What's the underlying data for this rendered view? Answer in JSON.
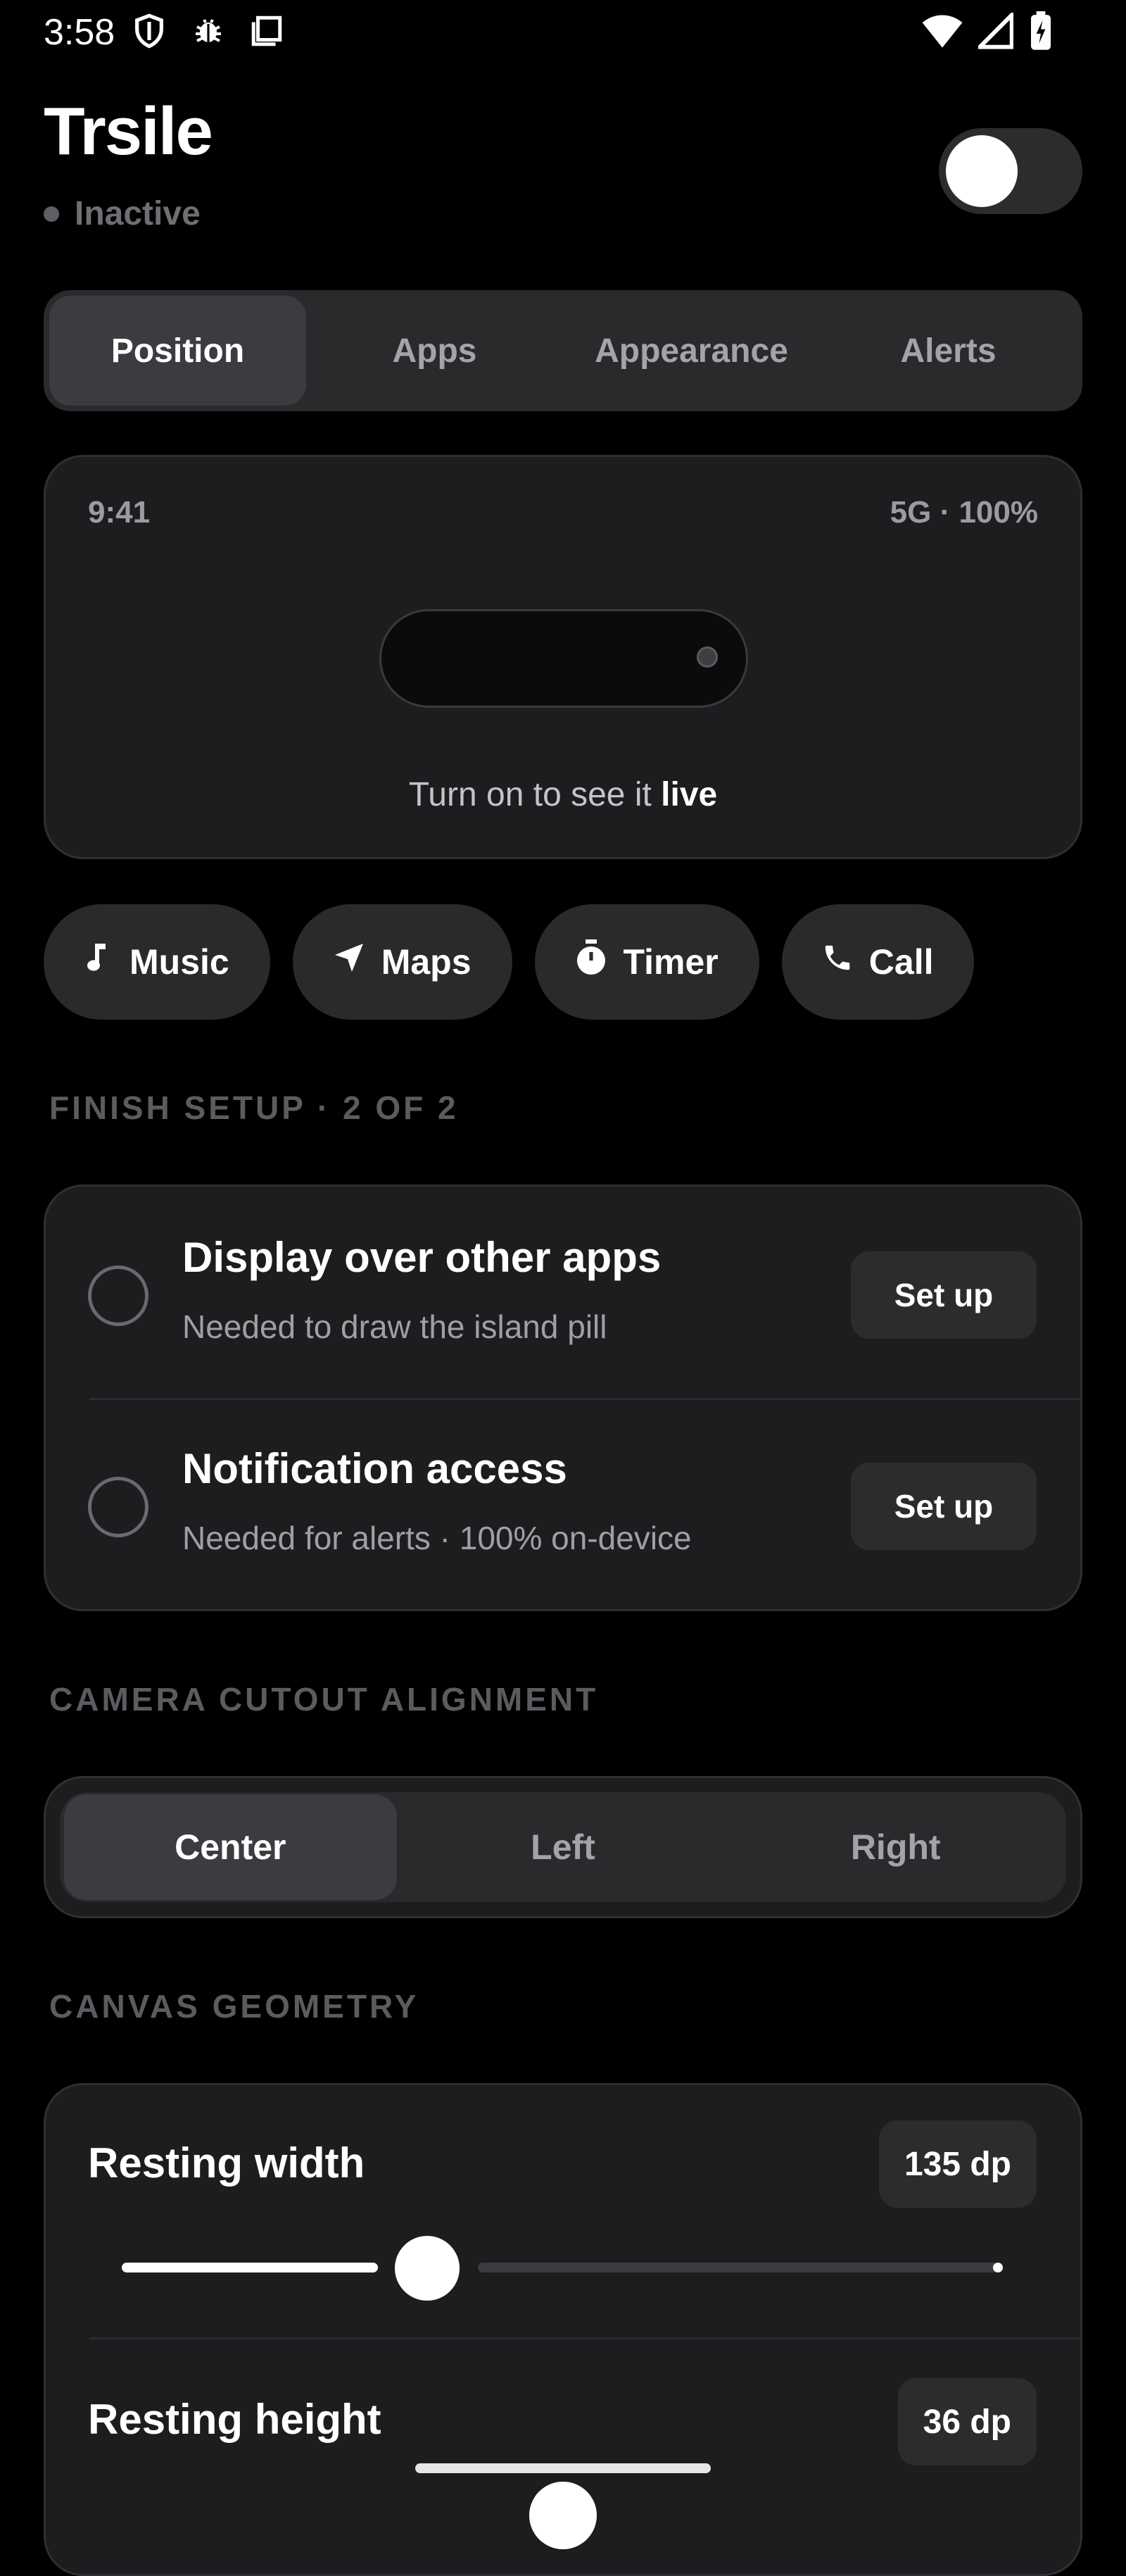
{
  "status_bar": {
    "time": "3:58",
    "left_icons": [
      "shield-icon",
      "bug-icon",
      "square-icon"
    ],
    "right_icons": [
      "wifi-icon",
      "signal-icon",
      "battery-charging-icon"
    ]
  },
  "header": {
    "title": "Trsile",
    "status": "Inactive",
    "toggle_on": false
  },
  "tabs": [
    {
      "label": "Position",
      "active": true
    },
    {
      "label": "Apps",
      "active": false
    },
    {
      "label": "Appearance",
      "active": false
    },
    {
      "label": "Alerts",
      "active": false
    }
  ],
  "preview": {
    "time": "9:41",
    "status": "5G · 100%",
    "hint_prefix": "Turn on to see it ",
    "hint_emphasis": "live"
  },
  "chips": [
    {
      "label": "Music",
      "icon": "music-note-icon"
    },
    {
      "label": "Maps",
      "icon": "navigation-arrow-icon"
    },
    {
      "label": "Timer",
      "icon": "stopwatch-icon"
    },
    {
      "label": "Call",
      "icon": "phone-icon"
    }
  ],
  "setup": {
    "header": "FINISH SETUP · 2 OF 2",
    "items": [
      {
        "title": "Display over other apps",
        "subtitle": "Needed to draw the island pill",
        "button": "Set up"
      },
      {
        "title": "Notification access",
        "subtitle": "Needed for alerts · 100% on-device",
        "button": "Set up"
      }
    ]
  },
  "alignment": {
    "header": "CAMERA CUTOUT ALIGNMENT",
    "options": [
      {
        "label": "Center",
        "active": true
      },
      {
        "label": "Left",
        "active": false
      },
      {
        "label": "Right",
        "active": false
      }
    ]
  },
  "geometry": {
    "header": "CANVAS GEOMETRY",
    "rows": [
      {
        "label": "Resting width",
        "value": "135 dp",
        "slider_fraction": 0.32
      },
      {
        "label": "Resting height",
        "value": "36 dp"
      }
    ]
  }
}
